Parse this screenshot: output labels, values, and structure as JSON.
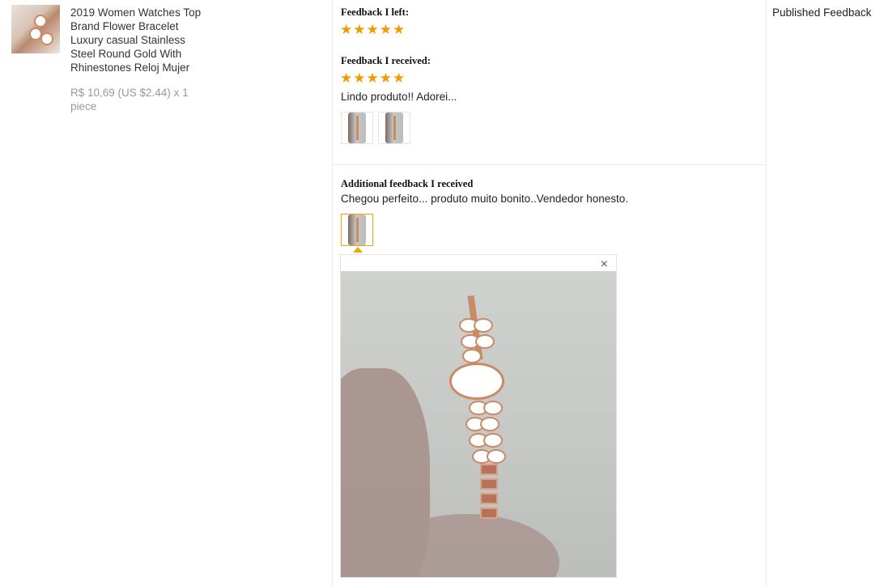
{
  "product": {
    "title": "2019 Women Watches Top Brand Flower Bracelet Luxury casual Stainless Steel Round Gold With Rhinestones Reloj Mujer",
    "price_line": "R$ 10,69 (US $2.44) x 1 piece",
    "thumbnail_icon": "watch-product-image"
  },
  "feedback": {
    "left_label": "Feedback I left:",
    "left_stars": 5,
    "received_label": "Feedback I received:",
    "received_stars": 5,
    "received_text": "Lindo produto!! Adorei...",
    "received_photo_count": 2,
    "additional_label": "Additional feedback I received",
    "additional_text": "Chegou perfeito... produto muito bonito..Vendedor honesto.",
    "additional_photo_count": 1,
    "star_color": "#f29b00",
    "active_thumb_color": "#f0a500"
  },
  "popup": {
    "close_icon": "×"
  },
  "status": {
    "label": "Published Feedback"
  }
}
